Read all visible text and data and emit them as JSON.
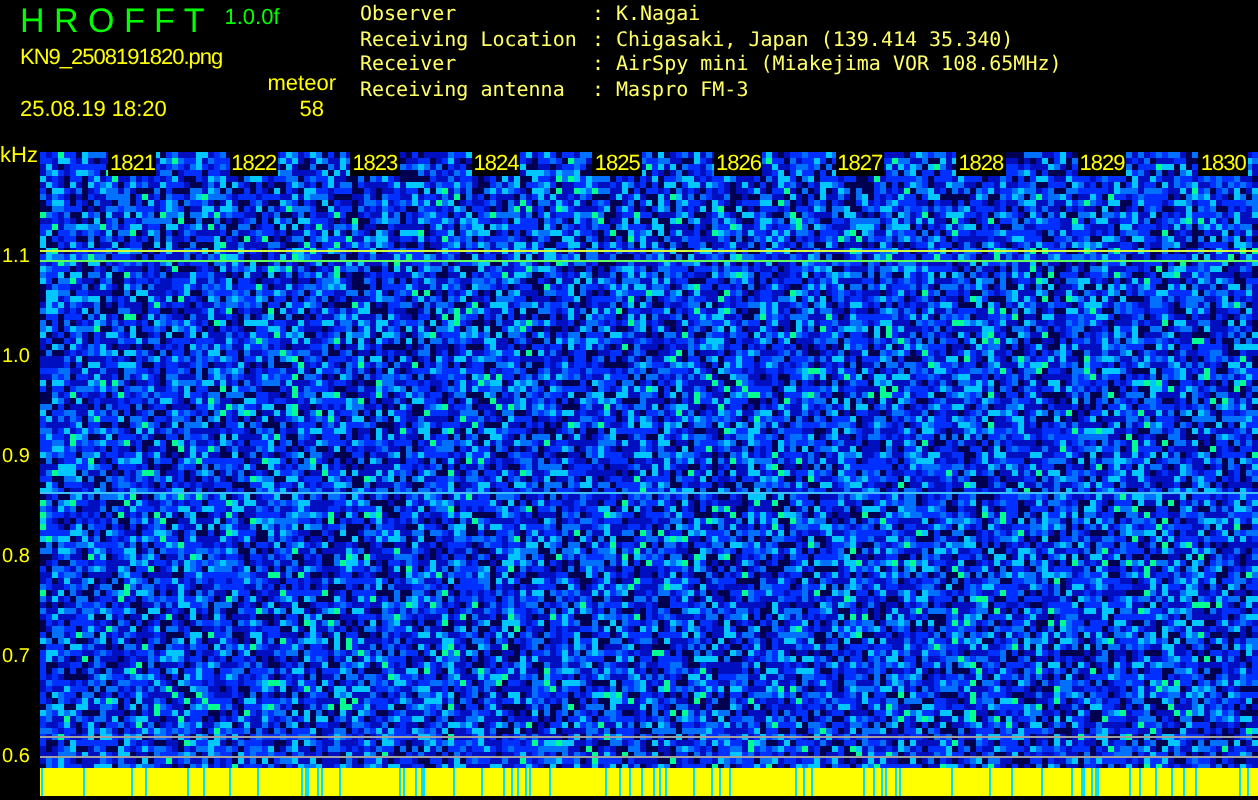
{
  "app": {
    "title": "H R O F F T",
    "version": "1.0.0f",
    "filename": "KN9_2508191820.png",
    "datetime": "25.08.19 18:20",
    "meteor_label": "meteor",
    "meteor_count": "58"
  },
  "info": [
    {
      "label": "Observer",
      "separator": ":",
      "value": "K.Nagai"
    },
    {
      "label": "Receiving Location",
      "separator": ":",
      "value": "Chigasaki, Japan (139.414 35.340)"
    },
    {
      "label": "Receiver",
      "separator": ":",
      "value": "AirSpy mini (Miakejima VOR 108.65MHz)"
    },
    {
      "label": "Receiving antenna",
      "separator": ":",
      "value": "Maspro FM-3"
    }
  ],
  "spectrogram": {
    "y_unit": "kHz",
    "y_labels": [
      "1.1",
      "1.0",
      "0.9",
      "0.8",
      "0.7",
      "0.6"
    ],
    "minute_labels": [
      "1821",
      "1822",
      "1823",
      "1824",
      "1825",
      "1826",
      "1827",
      "1828",
      "1829",
      "1830"
    ]
  }
}
